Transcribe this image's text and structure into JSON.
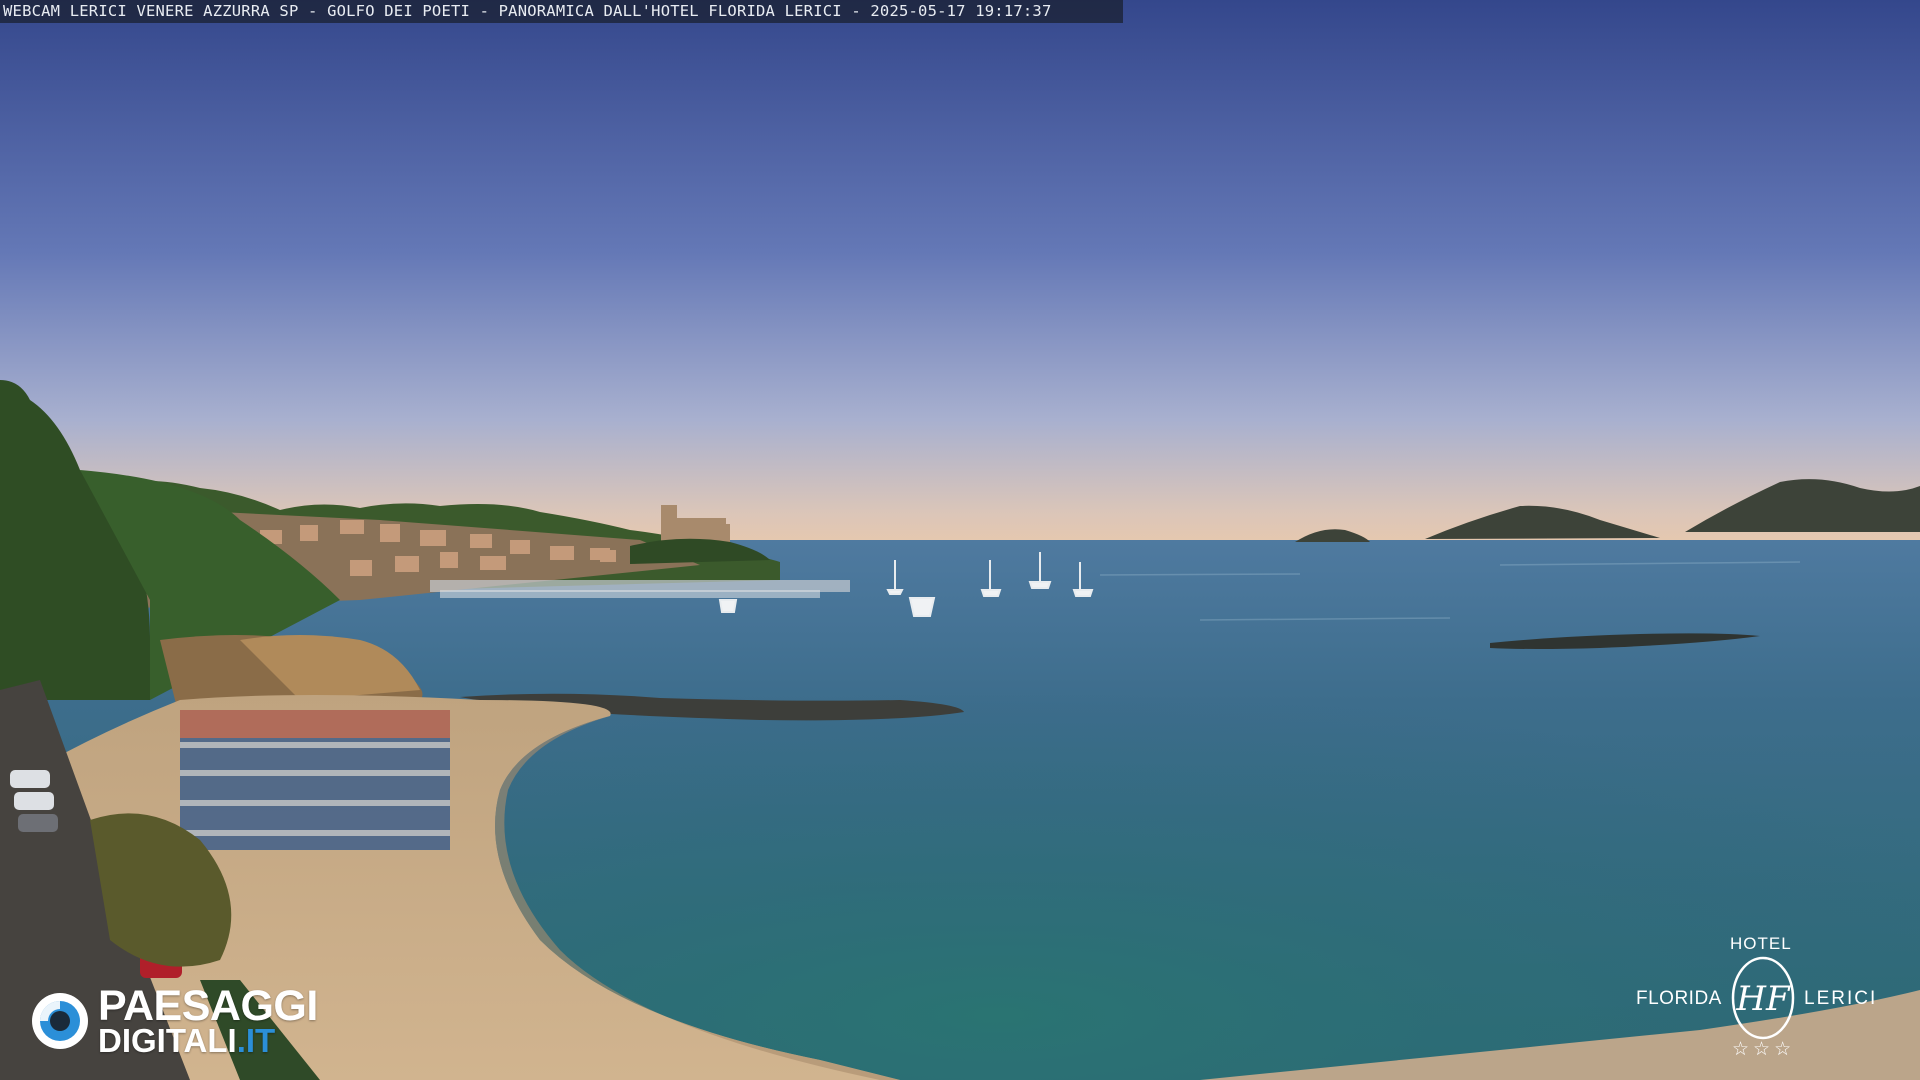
{
  "caption": {
    "text": "WEBCAM LERICI VENERE AZZURRA SP - GOLFO DEI POETI - PANORAMICA DALL'HOTEL FLORIDA LERICI - 2025-05-17 19:17:37"
  },
  "scene": {
    "subject": "panoramic-bay-webcam",
    "colors": {
      "sky_top": "#3b4f93",
      "sky_mid": "#7a8fc2",
      "sky_horizon": "#e6c7b0",
      "sea_far": "#3e6e90",
      "sea_near": "#2a6d74",
      "sand": "#c9ab88",
      "hills": "#2b4a22",
      "islands": "#40453d",
      "castle": "#a88a6c"
    }
  },
  "logo_left": {
    "line1": "PAESAGGI",
    "line2_main": "DIGITALI",
    "line2_domain": ".IT",
    "icon": "eye-icon",
    "accent_color": "#2b8fd8"
  },
  "logo_right": {
    "hotel": "HOTEL",
    "name": "FLORIDA",
    "city": "LERICI",
    "monogram": "HF",
    "stars": "☆☆☆"
  }
}
